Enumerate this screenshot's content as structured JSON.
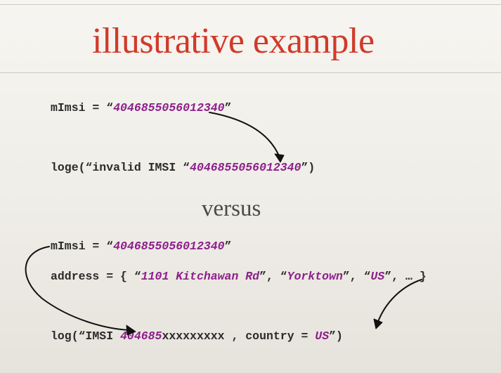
{
  "slide": {
    "title": "illustrative example",
    "separator": "versus"
  },
  "top_example": {
    "line1": {
      "prefix": "mImsi = “",
      "value": "4046855056012340",
      "suffix": "”"
    },
    "line2": {
      "prefix": "loge(“invalid IMSI “",
      "value": "4046855056012340",
      "suffix": "”)"
    }
  },
  "bottom_example": {
    "line1": {
      "prefix": "mImsi = “",
      "value": "4046855056012340",
      "suffix": "”"
    },
    "line2": {
      "prefix": "address = { “",
      "street": "1101 Kitchawan Rd",
      "sep1": "”, “",
      "city": "Yorktown",
      "sep2": "”, “",
      "country": "US",
      "suffix": "”, … }"
    },
    "line3": {
      "prefix": "log(“IMSI ",
      "imsi_prefix": "404685",
      "masked": "xxxxxxxxx",
      "middle": " , country = ",
      "country": "US",
      "suffix": "”)"
    }
  },
  "colors": {
    "title": "#d13a2a",
    "code": "#2b2b2b",
    "value": "#8e1f8c",
    "separator": "#4a4a4a",
    "arrow": "#111111"
  },
  "icons": [
    "curved-arrow"
  ]
}
